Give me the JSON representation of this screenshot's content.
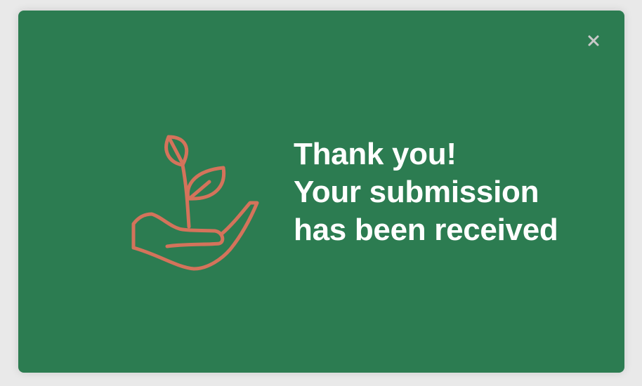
{
  "colors": {
    "backdrop": "#e9e9e9",
    "modal_background": "#2c7c51",
    "illustration_stroke": "#d4735b",
    "close_icon": "#c9c9c9",
    "text": "#ffffff"
  },
  "modal": {
    "close_icon": "close-icon",
    "illustration_icon": "hand-holding-sprout-icon",
    "message": {
      "line1": "Thank you!",
      "line2": "Your submission",
      "line3": "has been received"
    }
  }
}
